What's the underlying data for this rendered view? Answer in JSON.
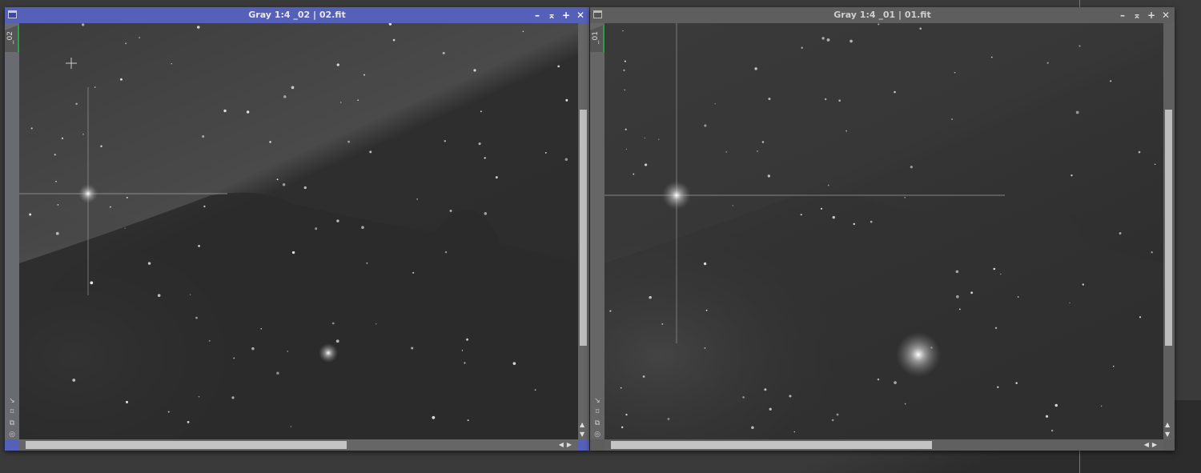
{
  "windows": [
    {
      "id": "left",
      "title": "Gray 1:4 _02 | 02.fit",
      "tab_label": "_02",
      "active": true,
      "controls": {
        "minimize": "–",
        "shade": "⌅",
        "maximize": "+",
        "close": "✕"
      },
      "side_icons": [
        "↘",
        "⌑",
        "⧉",
        "◎"
      ],
      "scroll": {
        "vertical_position": 0.22,
        "vertical_visible": 0.6,
        "horizontal_position": 0.0,
        "horizontal_visible": 0.6
      },
      "accent": "#5560b8"
    },
    {
      "id": "right",
      "title": "Gray 1:4 _01 | 01.fit",
      "tab_label": "_01",
      "active": false,
      "controls": {
        "minimize": "–",
        "shade": "⌅",
        "maximize": "+",
        "close": "✕"
      },
      "side_icons": [
        "↘",
        "⌑",
        "⧉",
        "◎"
      ],
      "scroll": {
        "vertical_position": 0.22,
        "vertical_visible": 0.6,
        "horizontal_position": 0.0,
        "horizontal_visible": 0.6
      },
      "accent": "#5e5e5e"
    }
  ],
  "arrows": {
    "up": "▲",
    "down": "▼",
    "left": "◀",
    "right": "▶"
  }
}
